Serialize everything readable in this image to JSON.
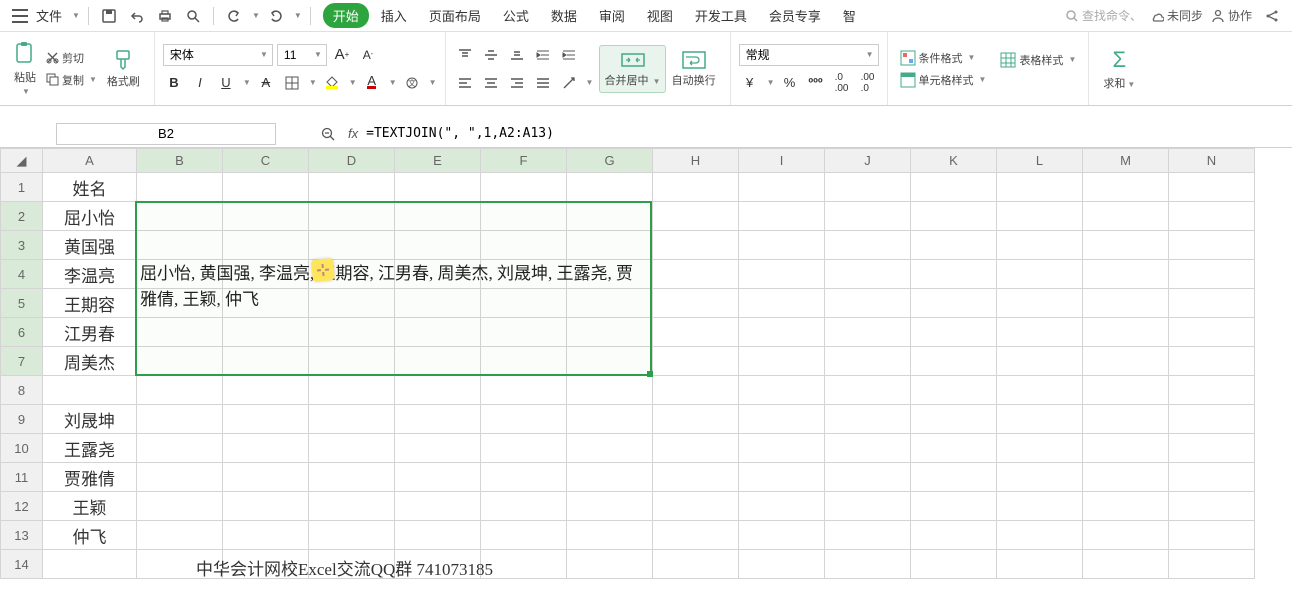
{
  "topbar": {
    "file_label": "文件",
    "search_placeholder": "查找命令、"
  },
  "top_right": {
    "sync": "未同步",
    "collab": "协作"
  },
  "tabs": [
    "开始",
    "插入",
    "页面布局",
    "公式",
    "数据",
    "审阅",
    "视图",
    "开发工具",
    "会员专享",
    "智"
  ],
  "ribbon": {
    "paste": "粘贴",
    "cut": "剪切",
    "copy": "复制",
    "format_painter": "格式刷",
    "font_name": "宋体",
    "font_size": "11",
    "merge_center": "合并居中",
    "wrap_text": "自动换行",
    "number_format": "常规",
    "cond_format": "条件格式",
    "table_style": "表格样式",
    "cell_style": "单元格样式",
    "sum": "求和"
  },
  "namebox": "B2",
  "formula": "=TEXTJOIN(\", \",1,A2:A13)",
  "columns": [
    "A",
    "B",
    "C",
    "D",
    "E",
    "F",
    "G",
    "H",
    "I",
    "J",
    "K",
    "L",
    "M",
    "N"
  ],
  "col_A": {
    "header": "姓名",
    "rows": [
      "屈小怡",
      "黄国强",
      "李温亮",
      "王期容",
      "江男春",
      "周美杰",
      "",
      "刘晟坤",
      "王露尧",
      "贾雅倩",
      "王颖",
      "仲飞"
    ]
  },
  "merged_cell_text": "屈小怡, 黄国强, 李温亮, 王期容, 江男春, 周美杰, 刘晟坤, 王露尧, 贾雅倩, 王颖, 仲飞",
  "footer_text": "中华会计网校Excel交流QQ群  741073185",
  "row_count": 14
}
